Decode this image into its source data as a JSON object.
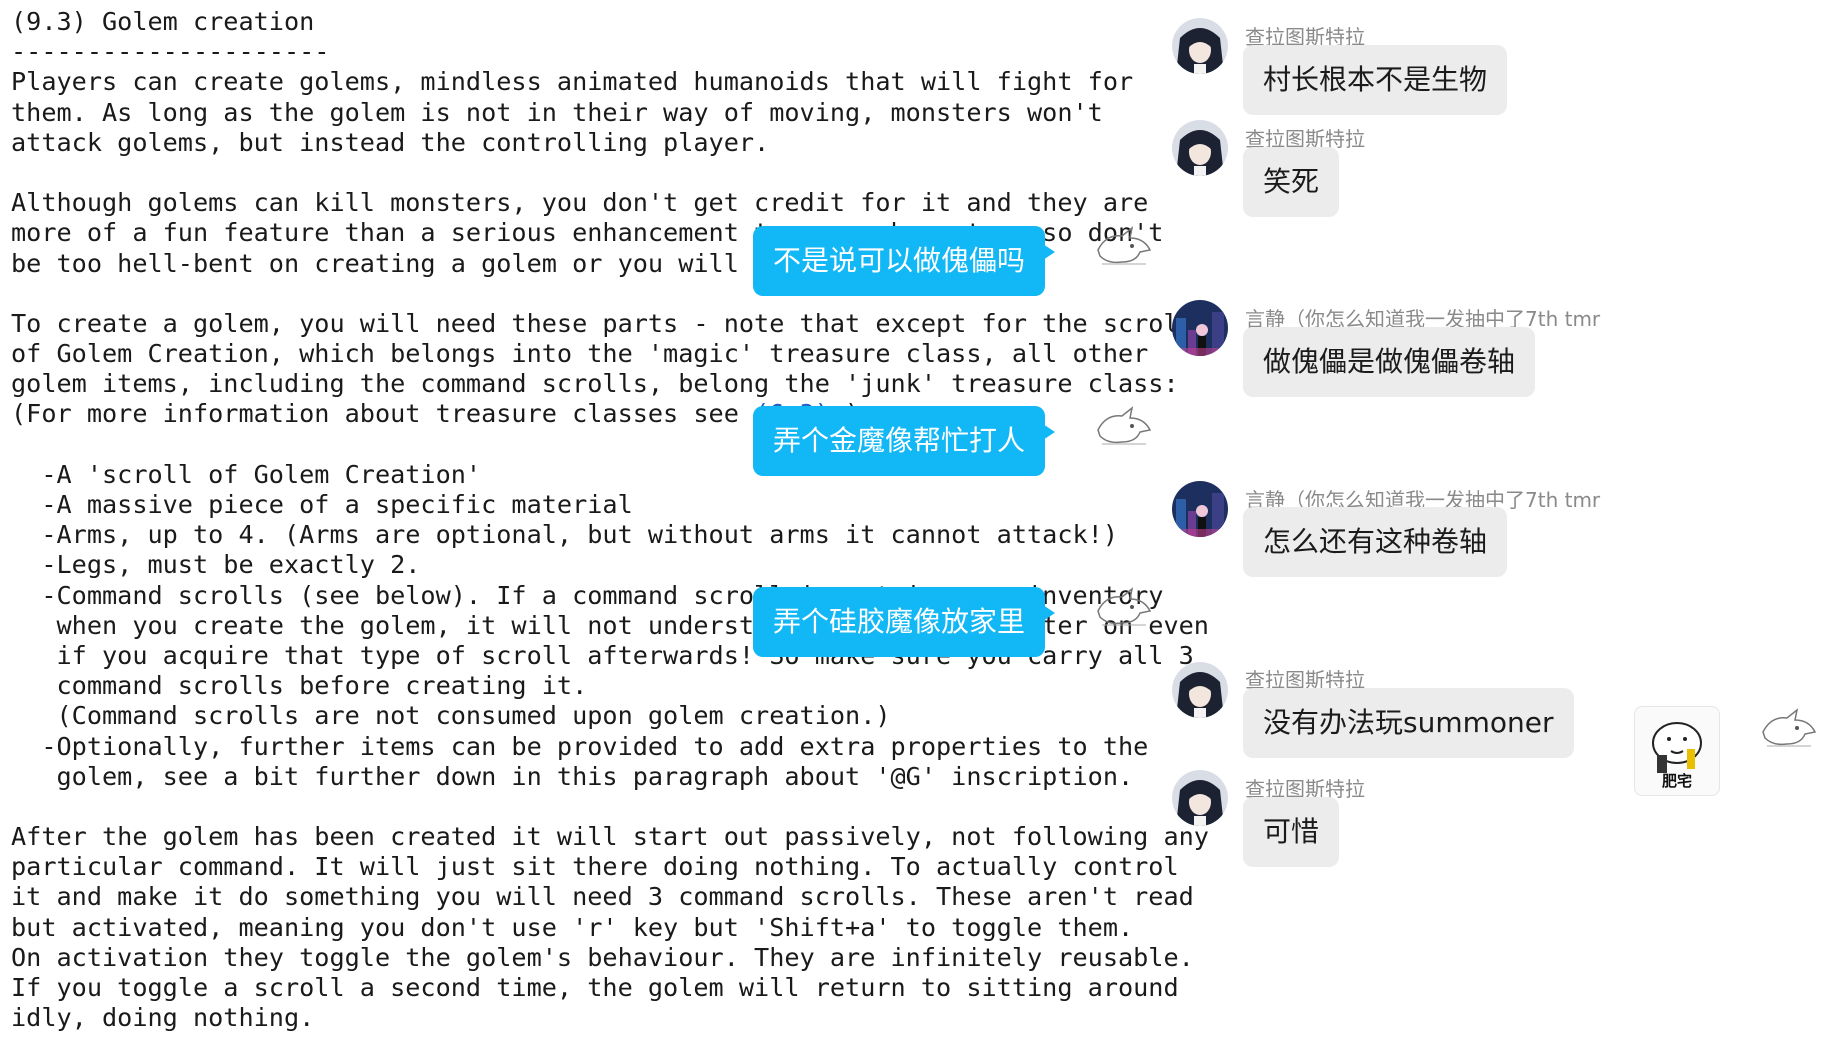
{
  "document": {
    "lines": [
      "(9.3) Golem creation",
      "---------------------",
      "Players can create golems, mindless animated humanoids that will fight for",
      "them. As long as the golem is not in their way of moving, monsters won't",
      "attack golems, but instead the controlling player.",
      "",
      "Although golems can kill monsters, you don't get credit for it and they are",
      "more of a fun feature than a serious enhancement to your character, so don't",
      "be too hell-bent on creating a golem or you will be disappointed.",
      "",
      "To create a golem, you will need these parts - note that except for the scroll",
      "of Golem Creation, which belongs into the 'magic' treasure class, all other",
      "golem items, including the command scrolls, belong the 'junk' treasure class:",
      "",
      "",
      "  -A 'scroll of Golem Creation'",
      "  -A massive piece of a specific material",
      "  -Arms, up to 4. (Arms are optional, but without arms it cannot attack!)",
      "  -Legs, must be exactly 2.",
      "  -Command scrolls (see below). If a command scroll is not in your inventory",
      "   when you create the golem, it will not understand that command later on even",
      "   if you acquire that type of scroll afterwards! So make sure you carry all 3",
      "   command scrolls before creating it.",
      "   (Command scrolls are not consumed upon golem creation.)",
      "  -Optionally, further items can be provided to add extra properties to the",
      "   golem, see a bit further down in this paragraph about '@G' inscription.",
      "",
      "After the golem has been created it will start out passively, not following any",
      "particular command. It will just sit there doing nothing. To actually control",
      "it and make it do something you will need 3 command scrolls. These aren't read",
      "but activated, meaning you don't use 'r' key but 'Shift+a' to toggle them.",
      "On activation they toggle the golem's behaviour. They are infinitely reusable.",
      "If you toggle a scroll a second time, the golem will return to sitting around",
      "idly, doing nothing."
    ],
    "ref_line": {
      "before": "(For more information about treasure classes see ",
      "link": "(6.3)",
      "after": ".)"
    }
  },
  "chat": {
    "messages": [
      {
        "side": "in",
        "sender": "查拉图斯特拉",
        "text": "村长根本不是生物",
        "avatar": "anime-girl-avatar"
      },
      {
        "side": "in",
        "sender": "查拉图斯特拉",
        "text": "笑死",
        "avatar": "anime-girl-avatar"
      },
      {
        "side": "out",
        "text": "不是说可以做傀儡吗",
        "avatar": "sketch-creature-avatar"
      },
      {
        "side": "in",
        "sender": "言静（你怎么知道我一发抽中了7th tmr",
        "text": "做傀儡是做傀儡卷轴",
        "avatar": "city-night-avatar"
      },
      {
        "side": "out",
        "text": "弄个金魔像帮忙打人",
        "avatar": "sketch-creature-avatar"
      },
      {
        "side": "in",
        "sender": "言静（你怎么知道我一发抽中了7th tmr",
        "text": "怎么还有这种卷轴",
        "avatar": "city-night-avatar"
      },
      {
        "side": "out",
        "text": "弄个硅胶魔像放家里",
        "avatar": "sketch-creature-avatar"
      },
      {
        "side": "in",
        "sender": "查拉图斯特拉",
        "text": "没有办法玩summoner",
        "avatar": "anime-girl-avatar"
      },
      {
        "side": "in",
        "sender": "查拉图斯特拉",
        "text": "可惜",
        "avatar": "anime-girl-avatar"
      }
    ],
    "sticker": {
      "label": "肥宅",
      "icon": "meme-sticker"
    },
    "colors": {
      "incoming_bubble": "#ececec",
      "outgoing_bubble": "#12b7f5",
      "sender_name": "#8a8a8a"
    }
  }
}
